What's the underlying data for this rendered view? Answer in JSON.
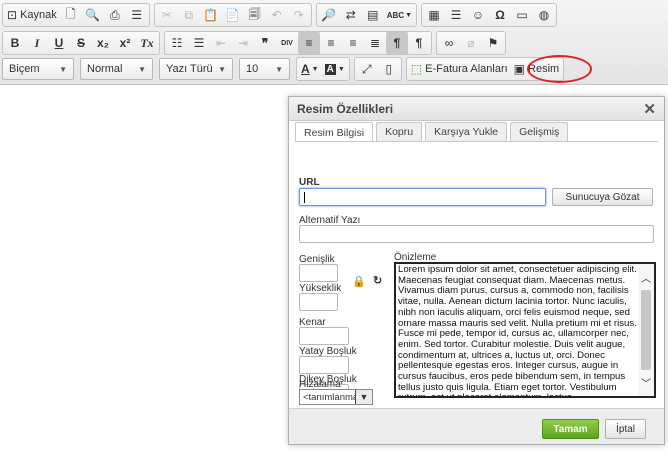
{
  "toolbar": {
    "row1": {
      "source_label": "Kaynak"
    },
    "row2": {
      "bold": "B",
      "italic": "I",
      "underline": "U",
      "strike": "S",
      "subscript": "x₂",
      "superscript": "x²",
      "remove_format": "Tx",
      "blockquote": "❞",
      "div": "DIV",
      "ltr": "¶",
      "rtl": "¶"
    },
    "row3": {
      "styles_combo": "Biçem",
      "format_combo": "Normal",
      "font_combo": "Yazı Türü",
      "size_combo": "10",
      "text_color": "A",
      "bg_color": "A",
      "efatura_label": "E-Fatura Alanları",
      "image_label": "Resim"
    },
    "row1_extra": {
      "abc": "ABC",
      "omega": "Ω"
    }
  },
  "dialog": {
    "title": "Resim Özellikleri",
    "tabs": [
      "Resim Bilgisi",
      "Kopru",
      "Karşıya Yukle",
      "Gelişmiş"
    ],
    "url_label": "URL",
    "url_value": "",
    "browse_button": "Sunucuya Gözat",
    "alt_label": "Alternatif Yazı",
    "width_label": "Genişlik",
    "height_label": "Yükseklik",
    "border_label": "Kenar",
    "hspace_label": "Yatay Boşluk",
    "vspace_label": "Dikey Boşluk",
    "align_label": "Hizalama",
    "align_value": "<tanımlanmamış>",
    "preview_label": "Önizleme",
    "preview_text": "Lorem ipsum dolor sit amet, consectetuer adipiscing elit. Maecenas feugiat consequat diam. Maecenas metus. Vivamus diam purus, cursus a, commodo non, facilisis vitae, nulla. Aenean dictum lacinia tortor. Nunc iaculis, nibh non iaculis aliquam, orci felis euismod neque, sed ornare massa mauris sed velit. Nulla pretium mi et risus. Fusce mi pede, tempor id, cursus ac, ullamcorper nec, enim. Sed tortor. Curabitur molestie. Duis velit augue, condimentum at, ultrices a, luctus ut, orci. Donec pellentesque egestas eros. Integer cursus, augue in cursus faucibus, eros pede bibendum sem, in tempus tellus justo quis ligula. Etiam eget tortor. Vestibulum rutrum, est ut placerat elementum, lectus",
    "ok_button": "Tamam",
    "cancel_button": "İptal"
  }
}
